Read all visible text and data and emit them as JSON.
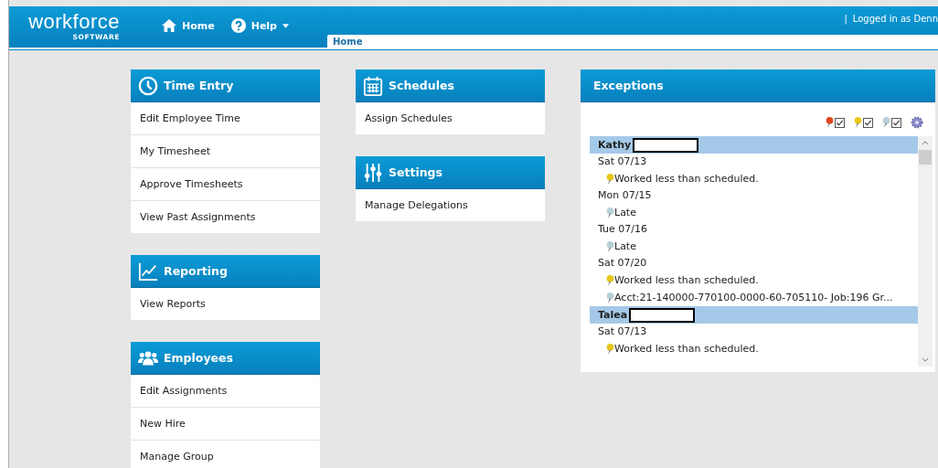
{
  "header": {
    "logo": {
      "word": "workforce",
      "sub": "SOFTWARE"
    },
    "nav": [
      {
        "label": "Home",
        "kind": "home",
        "dropdown": false
      },
      {
        "label": "Help",
        "kind": "help",
        "dropdown": true
      }
    ],
    "tabs": [
      {
        "label": "Home",
        "selected": true
      }
    ],
    "separator": "|",
    "login": "Logged in as Denn"
  },
  "columns": [
    {
      "panels": [
        {
          "title": "Time Entry",
          "kind": "clock",
          "items": [
            "Edit Employee Time",
            "My Timesheet",
            "Approve Timesheets",
            "View Past Assignments"
          ]
        },
        {
          "title": "Reporting",
          "kind": "chart",
          "items": [
            "View Reports"
          ]
        },
        {
          "title": "Employees",
          "kind": "people",
          "items": [
            "Edit Assignments",
            "New Hire",
            "Manage Group"
          ]
        }
      ]
    },
    {
      "panels": [
        {
          "title": "Schedules",
          "kind": "calendar",
          "items": [
            "Assign Schedules"
          ]
        },
        {
          "title": "Settings",
          "kind": "sliders",
          "items": [
            "Manage Delegations"
          ]
        }
      ]
    }
  ],
  "exceptions": {
    "title": "Exceptions",
    "filters": [
      {
        "color": "#e0461e",
        "checked": true
      },
      {
        "color": "#e8c81a",
        "checked": true
      },
      {
        "color": "#b8d0d8",
        "checked": true
      }
    ],
    "employees": [
      {
        "name": "Kathy",
        "redacted": true,
        "days": [
          {
            "date": "Sat 07/13",
            "entries": [
              {
                "kind": "warning",
                "text": "Worked less than scheduled."
              }
            ]
          },
          {
            "date": "Mon 07/15",
            "entries": [
              {
                "kind": "info",
                "text": "Late"
              }
            ]
          },
          {
            "date": "Tue 07/16",
            "entries": [
              {
                "kind": "info",
                "text": "Late"
              }
            ]
          },
          {
            "date": "Sat 07/20",
            "entries": [
              {
                "kind": "warning",
                "text": "Worked less than scheduled."
              },
              {
                "kind": "info",
                "text": "Acct:21-140000-770100-0000-60-705110- Job:196 Gr..."
              }
            ]
          }
        ]
      },
      {
        "name": "Talea",
        "redacted": true,
        "days": [
          {
            "date": "Sat 07/13",
            "entries": [
              {
                "kind": "warning",
                "text": "Worked less than scheduled."
              }
            ]
          }
        ]
      }
    ]
  }
}
